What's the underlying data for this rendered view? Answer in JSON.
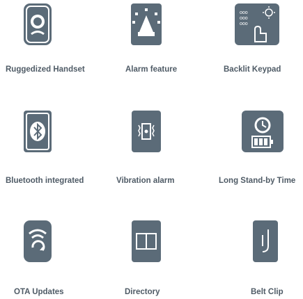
{
  "colors": {
    "icon_fill": "#5b6b78",
    "icon_light": "#ffffff",
    "label": "#4f5b66",
    "label_accent": "#4a6278"
  },
  "features": [
    {
      "label": "Ruggedized Handset",
      "icon": "rugged-handset-icon"
    },
    {
      "label": "Alarm feature",
      "icon": "alarm-icon"
    },
    {
      "label": "Backlit Keypad",
      "icon": "backlit-keypad-icon"
    },
    {
      "label": "Bluetooth integrated",
      "icon": "bluetooth-icon"
    },
    {
      "label": "Vibration alarm",
      "icon": "vibration-icon"
    },
    {
      "label": "Long Stand-by Time",
      "icon": "standby-battery-icon"
    },
    {
      "label": "OTA Updates",
      "icon": "ota-update-icon"
    },
    {
      "label": "Directory",
      "icon": "directory-book-icon"
    },
    {
      "label": "Belt Clip",
      "icon": "belt-clip-icon"
    }
  ]
}
